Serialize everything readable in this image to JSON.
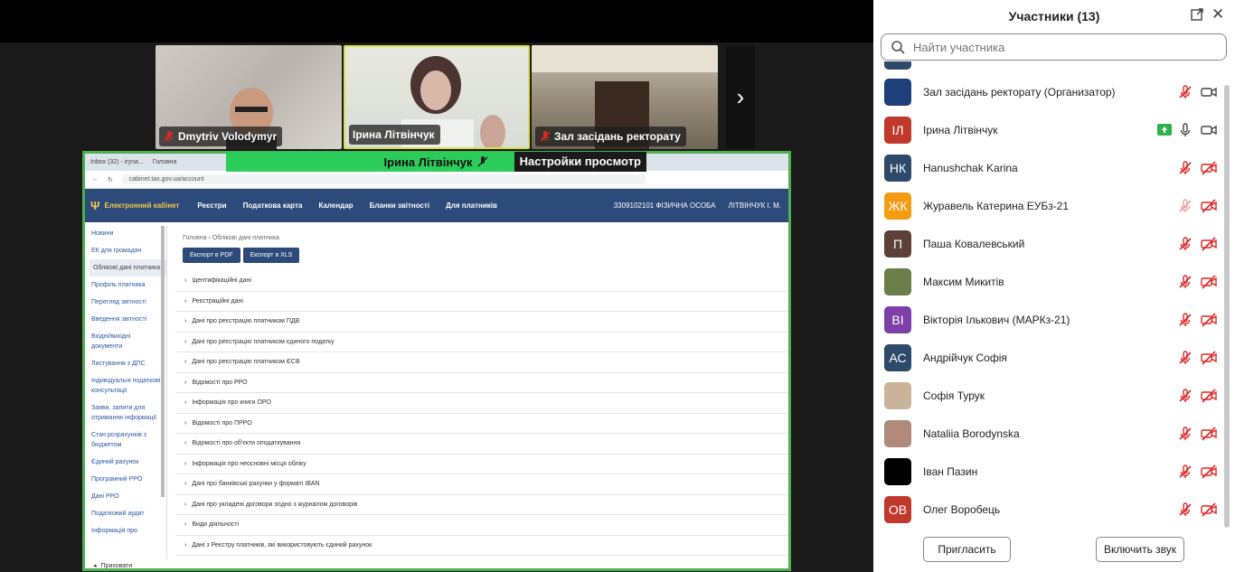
{
  "video_tiles": [
    {
      "name": "Dmytriv Volodymyr",
      "muted": true
    },
    {
      "name": "Ірина Літвінчук",
      "muted": false
    },
    {
      "name": "Зал засідань ректорату",
      "muted": true
    }
  ],
  "share_banner": {
    "presenter": "Ірина Літвінчук",
    "view_settings": "Настройки просмотр"
  },
  "browser": {
    "tabs": [
      "Inbox (32) - iryna...",
      "Головна"
    ],
    "url": "cabinet.tax.gov.ua/account"
  },
  "site": {
    "logo": "Електронний кабінет",
    "nav": [
      "Реєстри",
      "Податкова карта",
      "Календар",
      "Бланки звітності",
      "Для платників"
    ],
    "user_code": "3309102101 ФІЗИЧНА ОСОБА",
    "user_name": "ЛІТВІНЧУК І. М.",
    "breadcrumb_home": "Головна",
    "breadcrumb_current": "Облікові дані платника",
    "export_pdf": "Експорт в PDF",
    "export_xls": "Експорт в XLS",
    "sidebar": [
      "Новини",
      "ЕК для громадян",
      "Облікові дані платника",
      "Профіль платника",
      "Перегляд звітності",
      "Введення звітності",
      "Вхідні/вихідні документи",
      "Листування з ДПС",
      "Індивідуальні податкові консультації",
      "Заяви, запити для отримання інформації",
      "Стан розрахунків з бюджетом",
      "Єдиний рахунок",
      "Програмний РРО",
      "Дані РРО",
      "Податковий аудит",
      "Інформація про"
    ],
    "collapse": "Приховати",
    "sections": [
      "Ідентифікаційні дані",
      "Реєстраційні дані",
      "Дані про реєстрацію платником ПДВ",
      "Дані про реєстрацію платником єдиного податку",
      "Дані про реєстрацію платником ЄСВ",
      "Відомості про РРО",
      "Інформація про книги ОРО",
      "Відомості про ПРРО",
      "Відомості про об'єкти оподаткування",
      "Інформація про неосновні місця обліку",
      "Дані про банківські рахунки у форматі IBAN",
      "Дані про укладені договори згідно з журналом договорів",
      "Види діяльності",
      "Дані з Реєстру платників, які використовують єдиний рахунок"
    ]
  },
  "panel": {
    "title": "Участники (13)",
    "search_placeholder": "Найти участника",
    "participants": [
      {
        "initials": "",
        "name": "Зал засідань ректорату (Организатор)",
        "color": "#1e3f7a",
        "mic": "muted",
        "video": "on"
      },
      {
        "initials": "ІЛ",
        "name": "Ірина Літвінчук",
        "color": "#c0392b",
        "mic": "on",
        "video": "on",
        "sharing": true
      },
      {
        "initials": "НК",
        "name": "Hanushchak Karina",
        "color": "#2e4a6b",
        "mic": "muted",
        "video": "off"
      },
      {
        "initials": "ЖК",
        "name": "Журавель Катерина ЕУБз-21",
        "color": "#f39c12",
        "mic": "muted-light",
        "video": "off"
      },
      {
        "initials": "П",
        "name": "Паша Ковалевський",
        "color": "#5d4037",
        "mic": "muted",
        "video": "off"
      },
      {
        "initials": "",
        "name": "Максим Микитів",
        "color": "#6b7d4a",
        "mic": "muted",
        "video": "off"
      },
      {
        "initials": "ВІ",
        "name": "Вікторія Ількович (МАРКз-21)",
        "color": "#7e3fa8",
        "mic": "muted",
        "video": "off"
      },
      {
        "initials": "АС",
        "name": "Андрійчук Софія",
        "color": "#2e4a6b",
        "mic": "muted",
        "video": "off"
      },
      {
        "initials": "",
        "name": "Софія Турук",
        "color": "#c9b49a",
        "mic": "muted",
        "video": "off"
      },
      {
        "initials": "",
        "name": "Nataliia Borodynska",
        "color": "#b08a7a",
        "mic": "muted",
        "video": "off"
      },
      {
        "initials": "",
        "name": "Іван Пазин",
        "color": "#000000",
        "mic": "muted",
        "video": "off"
      },
      {
        "initials": "ОВ",
        "name": "Олег Воробець",
        "color": "#c0392b",
        "mic": "muted",
        "video": "off"
      }
    ],
    "invite": "Пригласить",
    "unmute_all": "Включить звук"
  },
  "colors": {
    "accent_green": "#2ccc5a",
    "mute_red": "#e02828",
    "site_navy": "#2c4a7a"
  }
}
